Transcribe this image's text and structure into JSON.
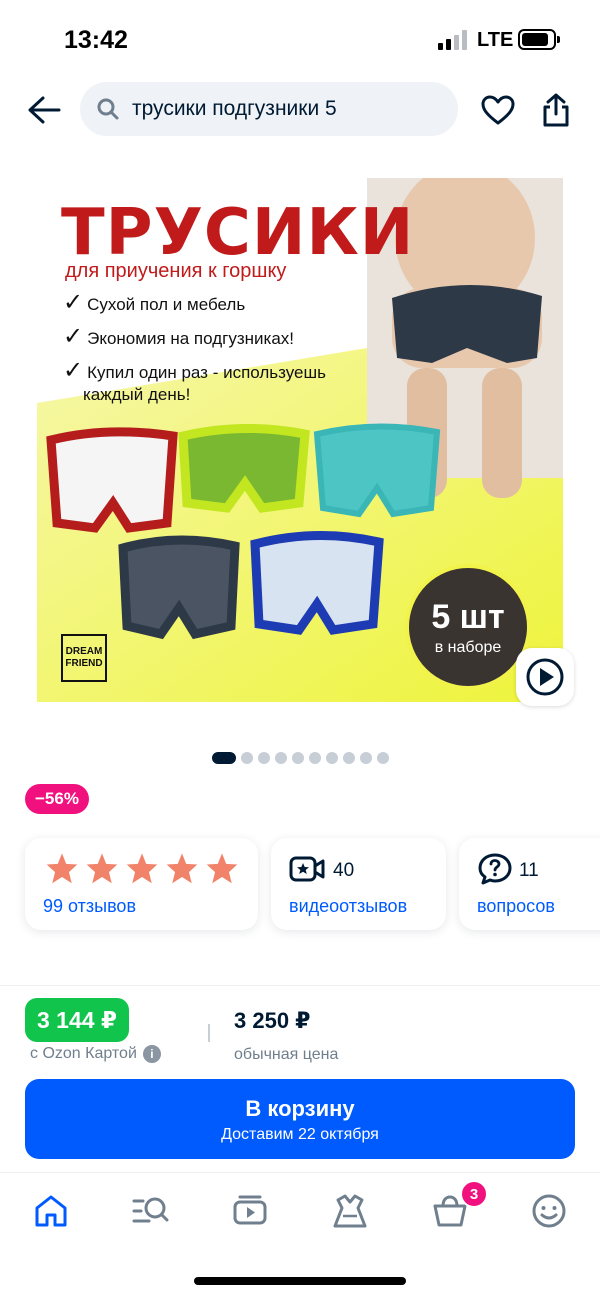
{
  "status": {
    "time": "13:42",
    "network": "LTE"
  },
  "search": {
    "query": "трусики подгузники 5"
  },
  "colors": {
    "accent": "#005bff",
    "discount": "#f1117e",
    "ozon_price": "#10c44c",
    "title_red": "#c11a1a"
  },
  "product_image": {
    "title": "ТРУСИКИ",
    "subtitle": "для приучения к горшку",
    "bullets": [
      "Сухой пол и мебель",
      "Экономия на подгузниках!",
      "Купил один раз - используешь",
      "каждый день!"
    ],
    "badge_count": "5 шт",
    "badge_text": "в наборе",
    "brand_line1": "DREAM",
    "brand_line2": "FRIEND",
    "carousel_total": 10,
    "carousel_active": 0
  },
  "discount_badge": "−56%",
  "cards": {
    "rating": {
      "stars": 5,
      "label": "99 отзывов"
    },
    "video": {
      "count": "40",
      "label": "видеоотзывов",
      "icon": "video-review-icon"
    },
    "questions": {
      "count": "11",
      "label": "вопросов",
      "icon": "question-icon"
    }
  },
  "price": {
    "ozon_price": "3 144 ₽",
    "ozon_note": "с Ozon Картой",
    "regular_price": "3 250 ₽",
    "regular_note": "обычная цена"
  },
  "cart_button": {
    "label": "В корзину",
    "delivery": "Доставим 22 октября"
  },
  "tabbar": {
    "items": [
      "home-icon",
      "catalog-search-icon",
      "video-icon",
      "fresh-icon",
      "cart-icon",
      "profile-icon"
    ],
    "cart_badge": "3"
  }
}
